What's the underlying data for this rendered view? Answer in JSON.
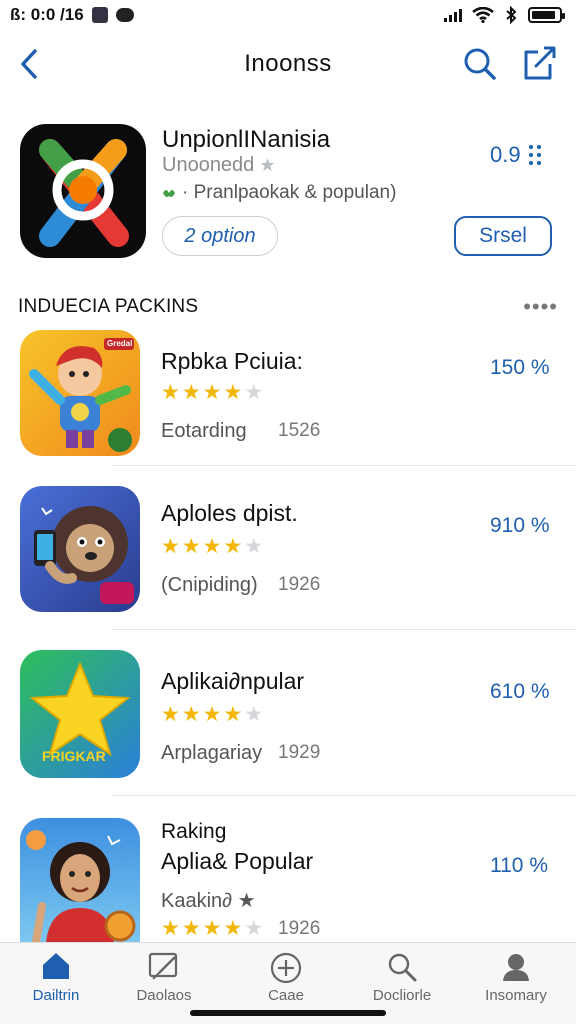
{
  "status_bar": {
    "time": "ß: 0:0 /16",
    "battery_level": 0.9
  },
  "nav": {
    "title": "Inoonss"
  },
  "featured": {
    "name": "UnpionlINanisia",
    "subtitle": "Unoonedd",
    "description": "· Pranlpaokak & populan)",
    "option_label": "2 option",
    "price": "0.9",
    "action_label": "Srsel"
  },
  "section": {
    "title": "INDUECIA PACKINS",
    "more": "••••"
  },
  "apps": [
    {
      "name": "Rpbka Pciuia:",
      "stars": 4,
      "meta": "Eotarding",
      "count": "1526",
      "price": "150 %",
      "icon": "cartoon-character-icon"
    },
    {
      "name": "Aploles dpist.",
      "stars": 4,
      "meta": "(Cnipiding)",
      "count": "1926",
      "price": "910 %",
      "icon": "lion-phone-icon"
    },
    {
      "name": "Aplikai∂npular",
      "stars": 4,
      "meta": "Arplagariay",
      "count": "1929",
      "price": "610 %",
      "icon": "star-icon"
    },
    {
      "name_line1": "Raking",
      "name": "Aplia& Popular",
      "stars": 4,
      "meta": "Kaakin∂ ★",
      "count": "1926",
      "price": "110 %",
      "icon": "girl-character-icon"
    }
  ],
  "app_tag_1": "Gredal",
  "app_tag_3": "FRIGKAR",
  "tabs": [
    {
      "label": "Dailtrin",
      "icon": "home-icon",
      "active": true
    },
    {
      "label": "Daolaos",
      "icon": "edit-icon",
      "active": false
    },
    {
      "label": "Caae",
      "icon": "plus-circle-icon",
      "active": false
    },
    {
      "label": "Docliorle",
      "icon": "search-icon",
      "active": false
    },
    {
      "label": "Insomary",
      "icon": "profile-icon",
      "active": false
    }
  ],
  "colors": {
    "accent": "#1f5fb0",
    "star": "#f2b705",
    "divider": "#e3e5e8"
  }
}
